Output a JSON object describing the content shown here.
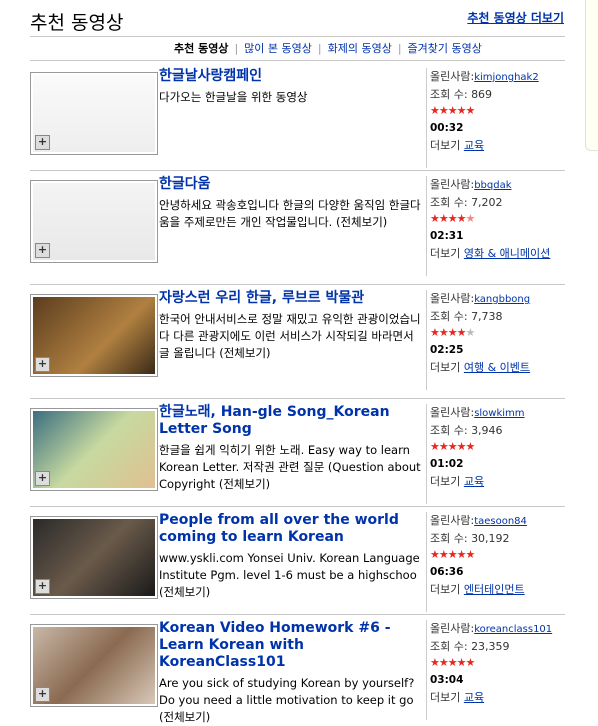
{
  "header": {
    "title": "추천 동영상",
    "more_link": "추천 동영상 더보기"
  },
  "tabs": [
    {
      "label": "추천 동영상",
      "active": true
    },
    {
      "label": "많이 본 동영상",
      "active": false
    },
    {
      "label": "화제의 동영상",
      "active": false
    },
    {
      "label": "즐겨찾기 동영상",
      "active": false
    }
  ],
  "labels": {
    "uploader": "올린사람:",
    "views": "조회 수:",
    "more": "더보기",
    "full_view": "(전체보기)"
  },
  "videos": [
    {
      "title": "한글날사랑캠페인",
      "desc": "다가오는 한글날을 위한 동영상",
      "full": "",
      "user": "kimjonghak2",
      "views": "869",
      "rating": 5,
      "duration": "00:32",
      "category": "교육"
    },
    {
      "title": "한글다움",
      "desc": "안녕하세요 곽송호입니다 한글의 다양한 움직임 한글다움을 주제로만든 개인 작업물입니다.",
      "full": "(전체보기)",
      "user": "bbqdak",
      "views": "7,202",
      "rating": 4.5,
      "duration": "02:31",
      "category": "영화 & 애니메이션"
    },
    {
      "title": "자랑스런 우리 한글, 루브르 박물관",
      "desc": "한국어 안내서비스로 정말 재밌고 유익한 관광이었습니다 다른 관광지에도 이런 서비스가 시작되길 바라면서 글 올립니다",
      "full": "(전체보기)",
      "user": "kangbbong",
      "views": "7,738",
      "rating": 4,
      "duration": "02:25",
      "category": "여행 & 이벤트"
    },
    {
      "title": "한글노래, Han-gle Song_Korean Letter Song",
      "desc": "한글을 쉽게 익히기 위한 노래. Easy way to learn Korean Letter. 저작권 관련 질문 (Question about Copyright",
      "full": "(전체보기)",
      "user": "slowkimm",
      "views": "3,946",
      "rating": 5,
      "duration": "01:02",
      "category": "교육"
    },
    {
      "title": "People from all over the world coming to learn Korean",
      "desc": "www.yskli.com Yonsei Univ. Korean Language Institute Pgm. level 1-6 must be a highschoo",
      "full": "(전체보기)",
      "user": "taesoon84",
      "views": "30,192",
      "rating": 5,
      "duration": "06:36",
      "category": "엔터테인먼트"
    },
    {
      "title": "Korean Video Homework #6 - Learn Korean with KoreanClass101",
      "desc": "Are you sick of studying Korean by yourself? Do you need a little motivation to keep it go",
      "full": "(전체보기)",
      "user": "koreanclass101",
      "views": "23,359",
      "rating": 5,
      "duration": "03:04",
      "category": "교육"
    }
  ],
  "colors": {
    "link": "#0033aa",
    "star": "#e8281e"
  }
}
